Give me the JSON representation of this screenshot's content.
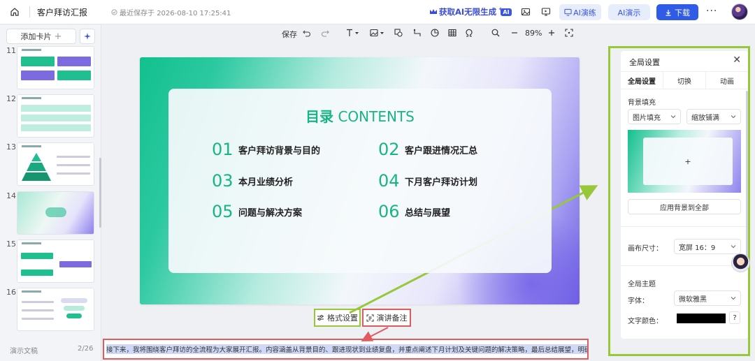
{
  "app": {
    "doc_title": "客户拜访汇报",
    "save_status": "最近保存于 2026-08-10 17:25:41",
    "promo": "获取AI无限生成",
    "ai_badge": "AI",
    "btn_ai_practice": "AI演练",
    "btn_ai_present": "AI演示",
    "btn_download": "下载",
    "more": "···"
  },
  "left_panel": {
    "add_card": "添加卡片",
    "slides": [
      {
        "num": "11"
      },
      {
        "num": "12"
      },
      {
        "num": "13"
      },
      {
        "num": "14"
      },
      {
        "num": "15"
      },
      {
        "num": "16"
      }
    ],
    "notes_label": "演示文稿",
    "page_count": "2/26"
  },
  "toolbar": {
    "save": "保存",
    "zoom": "89%"
  },
  "slide": {
    "title_cn": "目录",
    "title_en": "CONTENTS",
    "items": [
      {
        "num": "01",
        "text": "客户拜访背景与目的"
      },
      {
        "num": "02",
        "text": "客户跟进情况汇总"
      },
      {
        "num": "03",
        "text": "本月业绩分析"
      },
      {
        "num": "04",
        "text": "下月客户拜访计划"
      },
      {
        "num": "05",
        "text": "问题与解决方案"
      },
      {
        "num": "06",
        "text": "总结与展望"
      }
    ]
  },
  "canvas_buttons": {
    "format": "格式设置",
    "notes": "演讲备注"
  },
  "notes": {
    "text": "接下来，我将围绕客户拜访的全流程为大家展开汇报。内容涵盖从背景目的、跟进现状到业绩复盘，并重点阐述下月计划及关键问题的解决策略，最后总结展望，明确后续行动方向。"
  },
  "right_panel": {
    "title": "全局设置",
    "tabs": [
      "全局设置",
      "切换",
      "动画"
    ],
    "bg_fill_label": "背景填充",
    "fill_type": "图片填充",
    "fill_mode": "缩放铺满",
    "apply_all": "应用背景到全部",
    "canvas_size_label": "画布尺寸：",
    "canvas_size": "宽屏 16：9",
    "theme_label": "全局主题",
    "font_label": "字体：",
    "font_value": "微软雅黑",
    "text_color_label": "文字颜色：",
    "help": "?"
  },
  "colors": {
    "accent_green": "#17b585",
    "brand_blue": "#2f5be6",
    "highlight_green": "#97c83a",
    "highlight_red": "#e05a5e"
  }
}
